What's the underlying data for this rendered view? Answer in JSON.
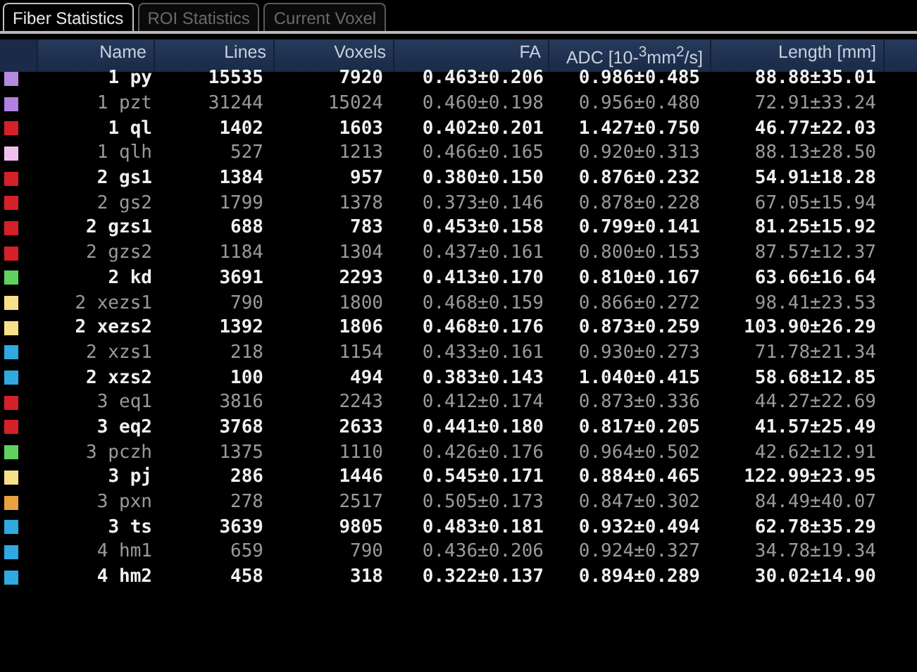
{
  "tabs": [
    {
      "label": "Fiber Statistics",
      "selected": true
    },
    {
      "label": "ROI Statistics",
      "selected": false
    },
    {
      "label": "Current Voxel",
      "selected": false
    }
  ],
  "table": {
    "columns": [
      "Name",
      "Lines",
      "Voxels",
      "FA",
      "ADC  [10-$^{3}$mm$^{2}$/s]",
      "Length [mm]"
    ],
    "rows": [
      {
        "color": "#b48ae0",
        "name": "1 py",
        "lines": "15535",
        "voxels": "7920",
        "fa": "0.463±0.206",
        "adc": "0.986±0.485",
        "length": "88.88±35.01"
      },
      {
        "color": "#b07fe0",
        "name": "1 pzt",
        "lines": "31244",
        "voxels": "15024",
        "fa": "0.460±0.198",
        "adc": "0.956±0.480",
        "length": "72.91±33.24"
      },
      {
        "color": "#d42028",
        "name": "1 ql",
        "lines": "1402",
        "voxels": "1603",
        "fa": "0.402±0.201",
        "adc": "1.427±0.750",
        "length": "46.77±22.03"
      },
      {
        "color": "#f0c0f0",
        "name": "1 qlh",
        "lines": "527",
        "voxels": "1213",
        "fa": "0.466±0.165",
        "adc": "0.920±0.313",
        "length": "88.13±28.50"
      },
      {
        "color": "#d42028",
        "name": "2 gs1",
        "lines": "1384",
        "voxels": "957",
        "fa": "0.380±0.150",
        "adc": "0.876±0.232",
        "length": "54.91±18.28"
      },
      {
        "color": "#d42028",
        "name": "2 gs2",
        "lines": "1799",
        "voxels": "1378",
        "fa": "0.373±0.146",
        "adc": "0.878±0.228",
        "length": "67.05±15.94"
      },
      {
        "color": "#d42028",
        "name": "2 gzs1",
        "lines": "688",
        "voxels": "783",
        "fa": "0.453±0.158",
        "adc": "0.799±0.141",
        "length": "81.25±15.92"
      },
      {
        "color": "#d42028",
        "name": "2 gzs2",
        "lines": "1184",
        "voxels": "1304",
        "fa": "0.437±0.161",
        "adc": "0.800±0.153",
        "length": "87.57±12.37"
      },
      {
        "color": "#60d060",
        "name": "2 kd",
        "lines": "3691",
        "voxels": "2293",
        "fa": "0.413±0.170",
        "adc": "0.810±0.167",
        "length": "63.66±16.64"
      },
      {
        "color": "#f8e08a",
        "name": "2 xezs1",
        "lines": "790",
        "voxels": "1800",
        "fa": "0.468±0.159",
        "adc": "0.866±0.272",
        "length": "98.41±23.53"
      },
      {
        "color": "#f8e08a",
        "name": "2 xezs2",
        "lines": "1392",
        "voxels": "1806",
        "fa": "0.468±0.176",
        "adc": "0.873±0.259",
        "length": "103.90±26.29"
      },
      {
        "color": "#30a8e0",
        "name": "2 xzs1",
        "lines": "218",
        "voxels": "1154",
        "fa": "0.433±0.161",
        "adc": "0.930±0.273",
        "length": "71.78±21.34"
      },
      {
        "color": "#30a8e0",
        "name": "2 xzs2",
        "lines": "100",
        "voxels": "494",
        "fa": "0.383±0.143",
        "adc": "1.040±0.415",
        "length": "58.68±12.85"
      },
      {
        "color": "#d42028",
        "name": "3 eq1",
        "lines": "3816",
        "voxels": "2243",
        "fa": "0.412±0.174",
        "adc": "0.873±0.336",
        "length": "44.27±22.69"
      },
      {
        "color": "#d42028",
        "name": "3 eq2",
        "lines": "3768",
        "voxels": "2633",
        "fa": "0.441±0.180",
        "adc": "0.817±0.205",
        "length": "41.57±25.49"
      },
      {
        "color": "#60d060",
        "name": "3 pczh",
        "lines": "1375",
        "voxels": "1110",
        "fa": "0.426±0.176",
        "adc": "0.964±0.502",
        "length": "42.62±12.91"
      },
      {
        "color": "#f8e08a",
        "name": "3 pj",
        "lines": "286",
        "voxels": "1446",
        "fa": "0.545±0.171",
        "adc": "0.884±0.465",
        "length": "122.99±23.95"
      },
      {
        "color": "#e8a040",
        "name": "3 pxn",
        "lines": "278",
        "voxels": "2517",
        "fa": "0.505±0.173",
        "adc": "0.847±0.302",
        "length": "84.49±40.07"
      },
      {
        "color": "#30a8e0",
        "name": "3 ts",
        "lines": "3639",
        "voxels": "9805",
        "fa": "0.483±0.181",
        "adc": "0.932±0.494",
        "length": "62.78±35.29"
      },
      {
        "color": "#30a8e0",
        "name": "4 hm1",
        "lines": "659",
        "voxels": "790",
        "fa": "0.436±0.206",
        "adc": "0.924±0.327",
        "length": "34.78±19.34"
      },
      {
        "color": "#30a8e0",
        "name": "4 hm2",
        "lines": "458",
        "voxels": "318",
        "fa": "0.322±0.137",
        "adc": "0.894±0.289",
        "length": "30.02±14.90"
      }
    ]
  }
}
